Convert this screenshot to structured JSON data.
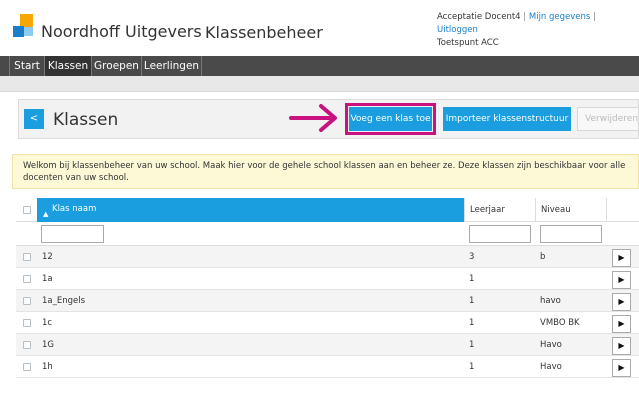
{
  "header": {
    "brand": "Noordhoff Uitgevers",
    "app_title": "Klassenbeheer",
    "user": {
      "name": "Acceptatie Docent4",
      "separator": "|",
      "links": [
        "Mijn gegevens",
        "Uitloggen"
      ],
      "school": "Toetspunt ACC"
    }
  },
  "nav": {
    "items": [
      {
        "label": "Start",
        "active": false
      },
      {
        "label": "Klassen",
        "active": true
      },
      {
        "label": "Groepen",
        "active": false
      },
      {
        "label": "Leerlingen",
        "active": false
      }
    ]
  },
  "toolbar": {
    "back_label": "<",
    "title": "Klassen",
    "add_class": "Voeg een klas toe",
    "import_structure": "Importeer klassenstructuur",
    "delete": "Verwijderen"
  },
  "info_text": "Welkom bij klassenbeheer van uw school. Maak hier voor de gehele school klassen aan en beheer ze. Deze klassen zijn beschikbaar voor alle docenten van uw school.",
  "table": {
    "columns": {
      "name": "Klas naam",
      "year": "Leerjaar",
      "level": "Niveau"
    },
    "sort_indicator": "▲",
    "rows": [
      {
        "name": "12",
        "year": "3",
        "level": "b"
      },
      {
        "name": "1a",
        "year": "1",
        "level": ""
      },
      {
        "name": "1a_Engels",
        "year": "1",
        "level": "havo"
      },
      {
        "name": "1c",
        "year": "1",
        "level": "VMBO BK"
      },
      {
        "name": "1G",
        "year": "1",
        "level": "Havo"
      },
      {
        "name": "1h",
        "year": "1",
        "level": "Havo"
      }
    ],
    "row_action_icon": "▶"
  },
  "colors": {
    "accent_blue": "#1a9ee0",
    "nav_bg": "#4a4a4a",
    "highlight": "#c7127f",
    "info_bg": "#fdf8d6"
  }
}
